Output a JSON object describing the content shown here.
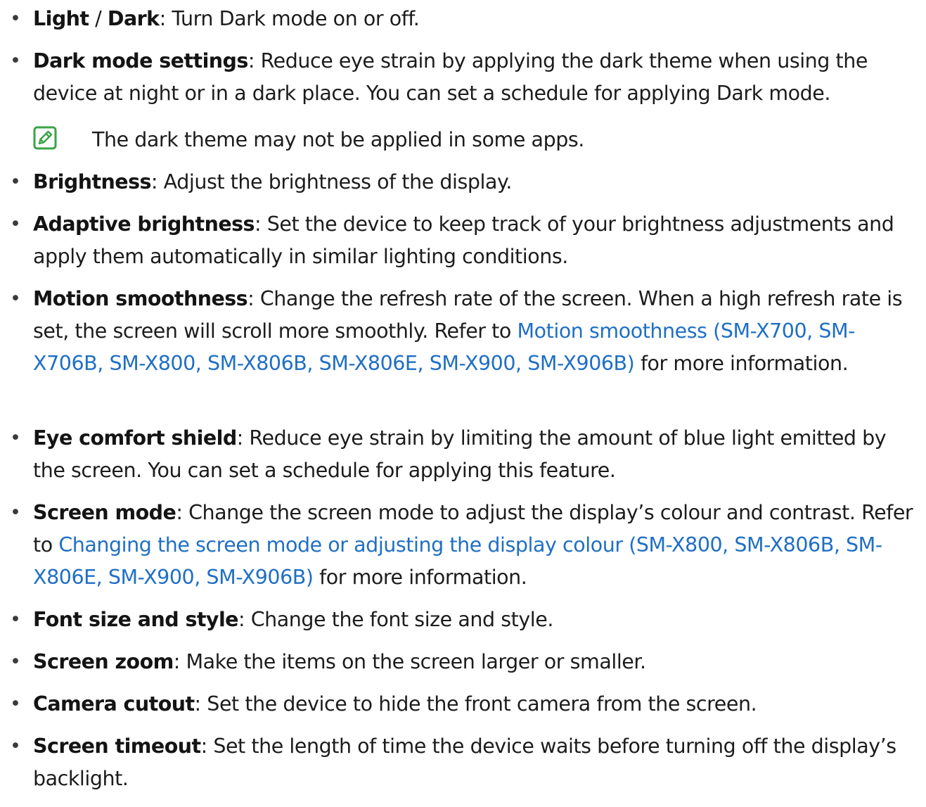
{
  "items": [
    {
      "term_a": "Light",
      "sep": " / ",
      "term_b": "Dark",
      "desc": ": Turn Dark mode on or off."
    },
    {
      "term": "Dark mode settings",
      "desc": ": Reduce eye strain by applying the dark theme when using the device at night or in a dark place. You can set a schedule for applying Dark mode."
    },
    {
      "term": "Brightness",
      "desc": ": Adjust the brightness of the display."
    },
    {
      "term": "Adaptive brightness",
      "desc": ": Set the device to keep track of your brightness adjustments and apply them automatically in similar lighting conditions."
    },
    {
      "term": "Motion smoothness",
      "desc": ": Change the refresh rate of the screen. When a high refresh rate is set, the screen will scroll more smoothly. Refer to ",
      "link": "Motion smoothness (SM-X700, SM-X706B, SM-X800, SM-X806B, SM-X806E, SM-X900, SM-X906B)",
      "after": " for more information."
    },
    {
      "term": "Eye comfort shield",
      "desc": ": Reduce eye strain by limiting the amount of blue light emitted by the screen. You can set a schedule for applying this feature."
    },
    {
      "term": "Screen mode",
      "desc": ": Change the screen mode to adjust the display’s colour and contrast. Refer to ",
      "link": "Changing the screen mode or adjusting the display colour (SM-X800, SM-X806B, SM-X806E, SM-X900, SM-X906B)",
      "after": " for more information."
    },
    {
      "term": "Font size and style",
      "desc": ": Change the font size and style."
    },
    {
      "term": "Screen zoom",
      "desc": ": Make the items on the screen larger or smaller."
    },
    {
      "term": "Camera cutout",
      "desc": ": Set the device to hide the front camera from the screen."
    },
    {
      "term": "Screen timeout",
      "desc": ": Set the length of time the device waits before turning off the display’s backlight."
    }
  ],
  "note": {
    "icon": "note-icon",
    "text": "The dark theme may not be applied in some apps."
  },
  "bullet_char": "•",
  "colors": {
    "text": "#1c1c1c",
    "link": "#1f6fc5",
    "note_icon": "#3aa345"
  }
}
